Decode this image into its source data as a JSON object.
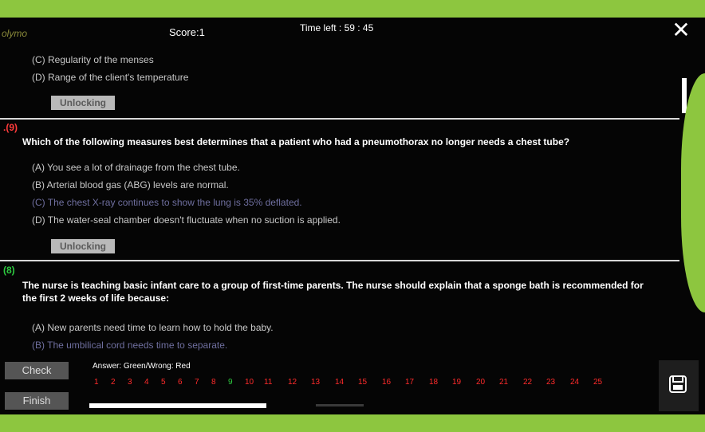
{
  "header": {
    "logo": "olymo",
    "score": "Score:1",
    "timer": "Time left : 59 : 45"
  },
  "prev_question": {
    "options": [
      "(C) Regularity of the menses",
      "(D) Range of the client's temperature"
    ],
    "unlock_label": "Unlocking"
  },
  "question9": {
    "number": ".(9)",
    "text": "Which of the following measures best determines that a patient who had a pneumothorax no longer needs a chest tube?",
    "options": [
      "(A) You see a lot of drainage from the chest tube.",
      "(B) Arterial blood gas (ABG) levels are normal.",
      "(C) The chest X-ray continues to show the lung is 35% deflated.",
      "(D) The water-seal chamber doesn't fluctuate when no suction is applied."
    ],
    "unlock_label": "Unlocking"
  },
  "question10": {
    "number": "(8)",
    "text": "The nurse is teaching basic infant care to a group of first-time parents. The nurse should explain that a sponge bath is recommended for the first 2 weeks of life because:",
    "options": [
      "(A) New parents need time to learn how to hold the baby.",
      "(B) The umbilical cord needs time to separate."
    ]
  },
  "footer": {
    "check_label": "Check",
    "finish_label": "Finish",
    "answer_legend": "Answer: Green/Wrong: Red",
    "question_numbers": [
      "1",
      "2",
      "3",
      "4",
      "5",
      "6",
      "7",
      "8",
      "9",
      "10",
      "11",
      "12",
      "13",
      "14",
      "15",
      "16",
      "17",
      "18",
      "19",
      "20",
      "21",
      "22",
      "23",
      "24",
      "25"
    ],
    "correct_number": "9",
    "progress_fraction": 0.3
  },
  "colors": {
    "frame_green": "#8dc63f",
    "correct": "#2ecc40",
    "wrong": "#ff2b2b",
    "selected_option": "#6f6f9f"
  },
  "icons": [
    "close-icon",
    "save-icon"
  ]
}
